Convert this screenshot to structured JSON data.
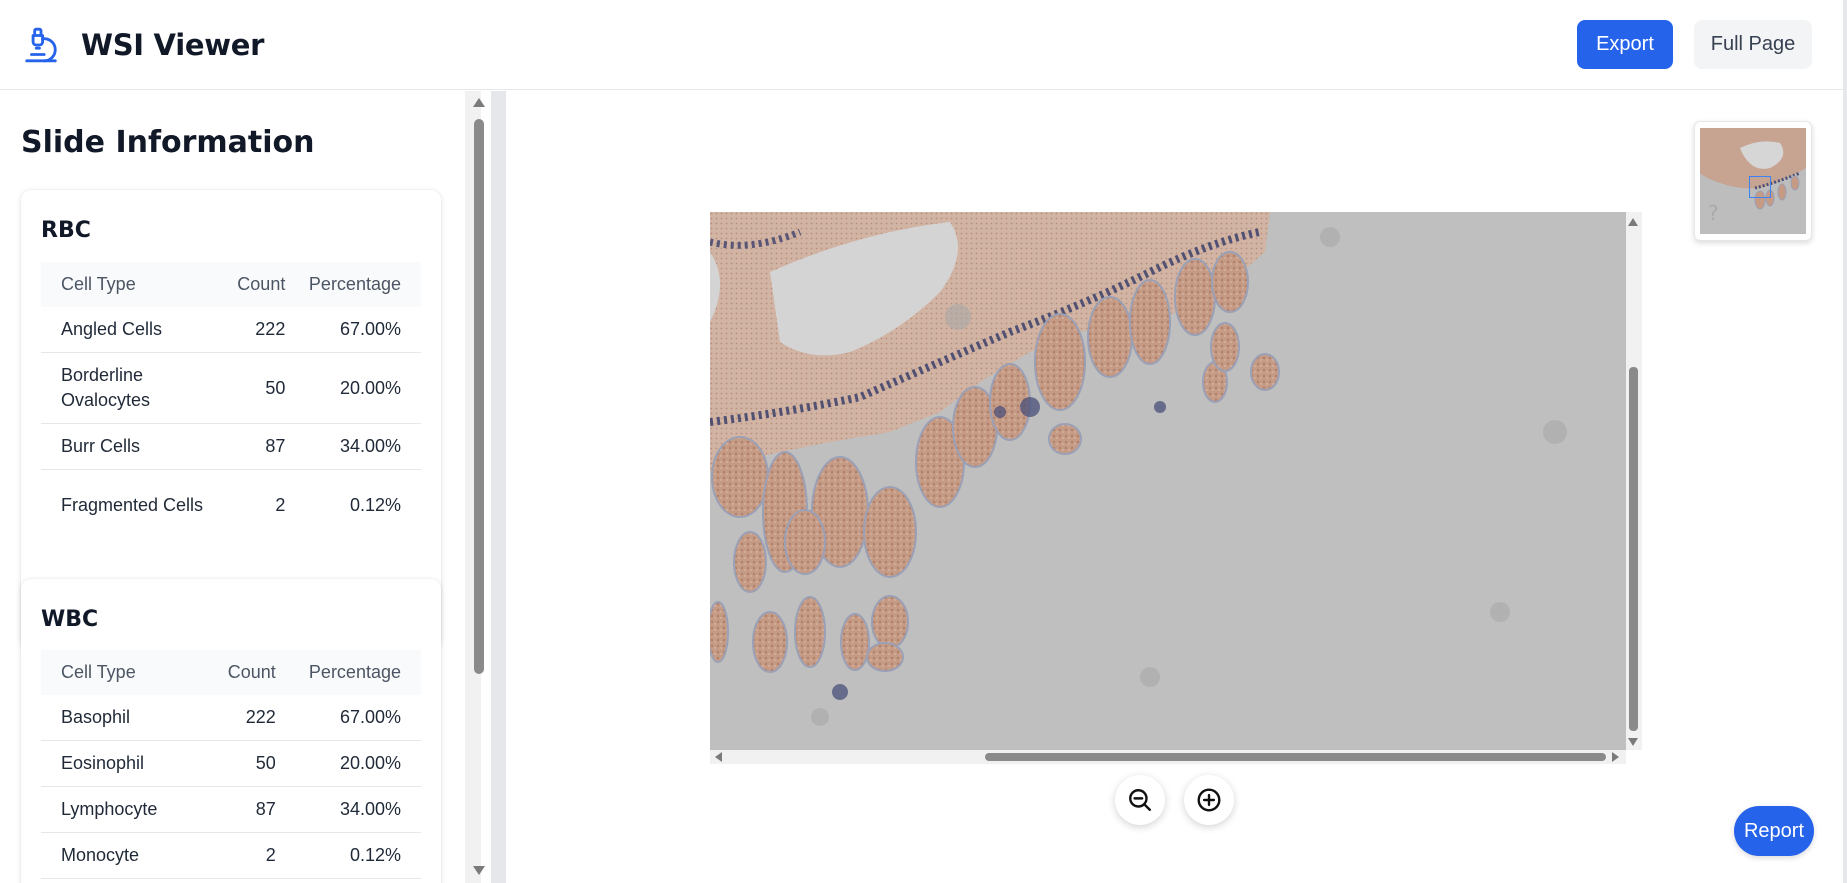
{
  "header": {
    "title": "WSI Viewer",
    "export_label": "Export",
    "fullpage_label": "Full Page"
  },
  "sidebar": {
    "title": "Slide Information",
    "sections": [
      {
        "name": "RBC",
        "columns": [
          "Cell Type",
          "Count",
          "Percentage"
        ],
        "rows": [
          {
            "type": "Angled Cells",
            "count": "222",
            "percentage": "67.00%"
          },
          {
            "type": "Borderline Ovalocytes",
            "count": "50",
            "percentage": "20.00%"
          },
          {
            "type": "Burr Cells",
            "count": "87",
            "percentage": "34.00%"
          },
          {
            "type": "Fragmented Cells",
            "count": "2",
            "percentage": "0.12%"
          }
        ]
      },
      {
        "name": "WBC",
        "columns": [
          "Cell Type",
          "Count",
          "Percentage"
        ],
        "rows": [
          {
            "type": "Basophil",
            "count": "222",
            "percentage": "67.00%"
          },
          {
            "type": "Eosinophil",
            "count": "50",
            "percentage": "20.00%"
          },
          {
            "type": "Lymphocyte",
            "count": "87",
            "percentage": "34.00%"
          },
          {
            "type": "Monocyte",
            "count": "2",
            "percentage": "0.12%"
          }
        ]
      }
    ]
  },
  "viewer": {
    "report_label": "Report",
    "zoom_out_icon": "zoom-out-icon",
    "zoom_in_icon": "zoom-in-icon"
  },
  "colors": {
    "accent": "#2563eb",
    "tissue": "#c49a84",
    "stain": "#3b3f6b",
    "background_slide": "#bfbfbf"
  }
}
